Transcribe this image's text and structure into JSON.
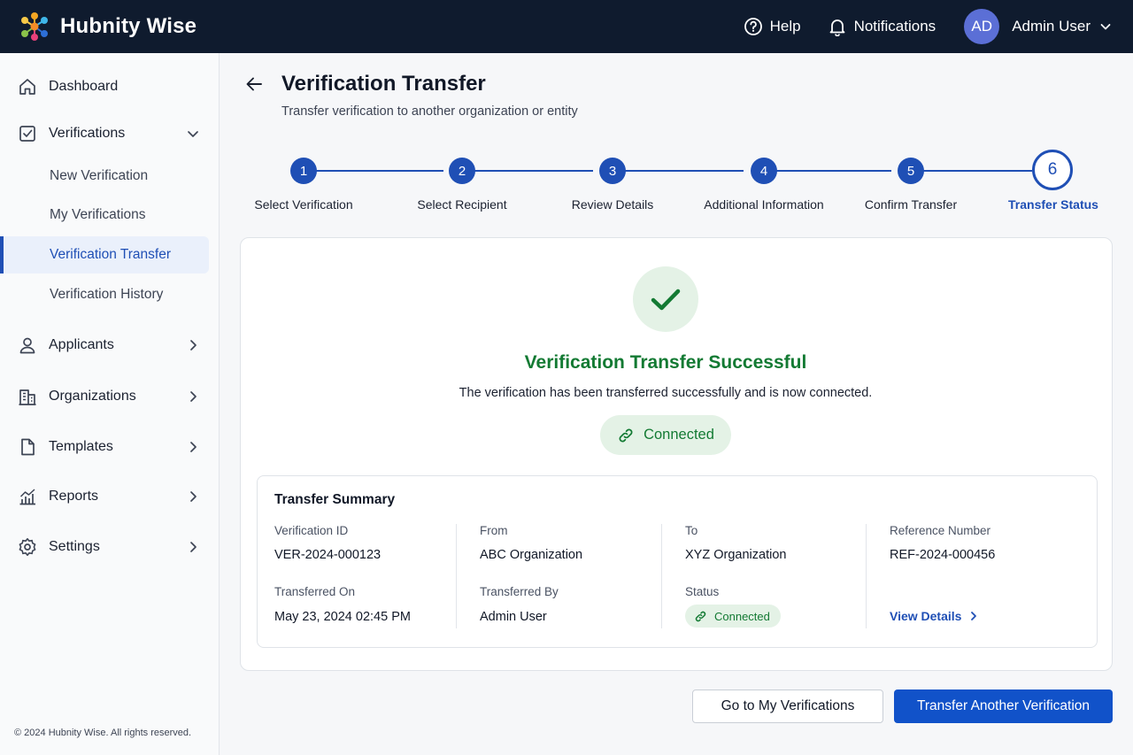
{
  "app": {
    "name": "Hubnity Wise",
    "colors": {
      "topbar": "#0f1b2e",
      "primary": "#1f4fb5",
      "success": "#137a33",
      "success_bg": "#e4f2e6"
    }
  },
  "topbar": {
    "help_label": "Help",
    "notifications_label": "Notifications",
    "user_initials": "AD",
    "user_name": "Admin User"
  },
  "sidebar": {
    "items": [
      {
        "label": "Dashboard",
        "icon": "home-icon"
      },
      {
        "label": "Verifications",
        "icon": "checkbox-icon",
        "expanded": true
      },
      {
        "label": "Applicants",
        "icon": "user-icon"
      },
      {
        "label": "Organizations",
        "icon": "building-icon"
      },
      {
        "label": "Templates",
        "icon": "document-icon"
      },
      {
        "label": "Reports",
        "icon": "chart-icon"
      },
      {
        "label": "Settings",
        "icon": "gear-icon"
      }
    ],
    "sub_items": [
      {
        "label": "New Verification"
      },
      {
        "label": "My Verifications"
      },
      {
        "label": "Verification Transfer",
        "active": true
      },
      {
        "label": "Verification History"
      }
    ],
    "copyright": "© 2024 Hubnity Wise. All rights reserved."
  },
  "page": {
    "title": "Verification Transfer",
    "subtitle": "Transfer verification to another organization or entity"
  },
  "stepper": {
    "current_step": 6,
    "steps": [
      {
        "number": "1",
        "label": "Select Verification"
      },
      {
        "number": "2",
        "label": "Select Recipient"
      },
      {
        "number": "3",
        "label": "Review Details"
      },
      {
        "number": "4",
        "label": "Additional Information"
      },
      {
        "number": "5",
        "label": "Confirm Transfer"
      },
      {
        "number": "6",
        "label": "Transfer Status"
      }
    ]
  },
  "result": {
    "title": "Verification Transfer Successful",
    "message": "The verification has been transferred successfully and is now connected.",
    "badge": "Connected"
  },
  "summary": {
    "title": "Transfer Summary",
    "verification_id_label": "Verification ID",
    "verification_id": "VER-2024-000123",
    "from_label": "From",
    "from": "ABC Organization",
    "to_label": "To",
    "to": "XYZ Organization",
    "reference_label": "Reference Number",
    "reference": "REF-2024-000456",
    "transferred_on_label": "Transferred On",
    "transferred_on": "May 23, 2024 02:45 PM",
    "transferred_by_label": "Transferred By",
    "transferred_by": "Admin User",
    "status_label": "Status",
    "status": "Connected",
    "view_details": "View Details"
  },
  "actions": {
    "secondary": "Go to My Verifications",
    "primary": "Transfer Another Verification"
  }
}
